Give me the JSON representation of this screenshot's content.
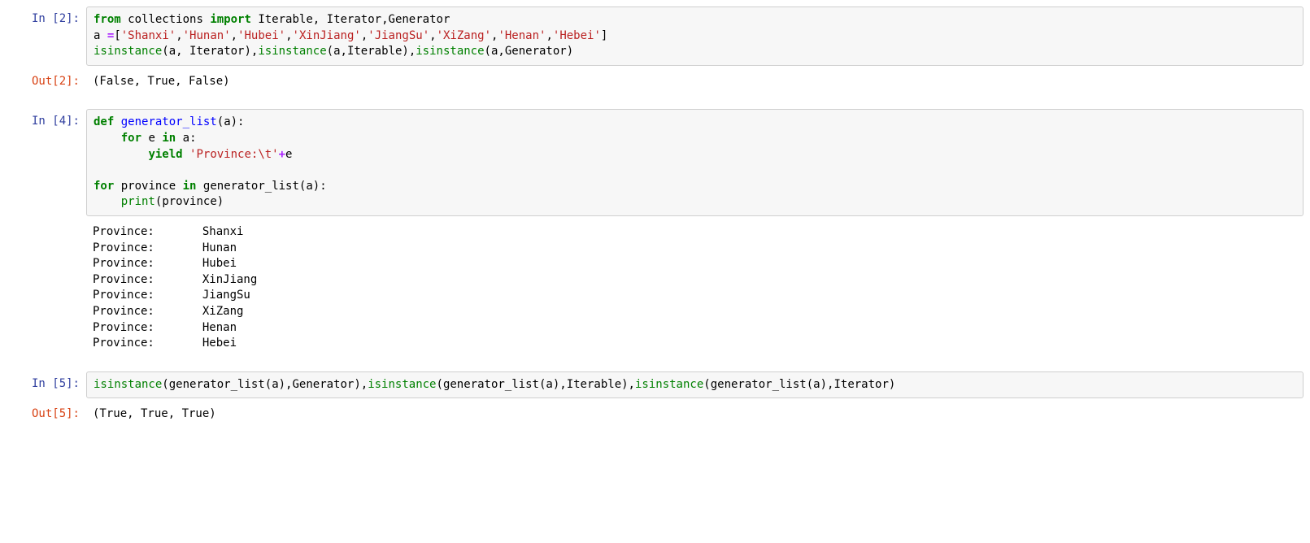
{
  "cells": [
    {
      "prompt_in": "In [2]:",
      "code_html": "<span class='kw-green'>from</span> <span class='name-black'>collections</span> <span class='kw-green'>import</span> <span class='name-black'>Iterable</span><span class='paren'>,</span> <span class='name-black'>Iterator</span><span class='paren'>,</span><span class='name-black'>Generator</span>\n<span class='name-black'>a</span> <span class='op'>=</span><span class='paren'>[</span><span class='str'>'Shanxi'</span><span class='paren'>,</span><span class='str'>'Hunan'</span><span class='paren'>,</span><span class='str'>'Hubei'</span><span class='paren'>,</span><span class='str'>'XinJiang'</span><span class='paren'>,</span><span class='str'>'JiangSu'</span><span class='paren'>,</span><span class='str'>'XiZang'</span><span class='paren'>,</span><span class='str'>'Henan'</span><span class='paren'>,</span><span class='str'>'Hebei'</span><span class='paren'>]</span>\n<span class='builtin'>isinstance</span><span class='paren'>(</span><span class='name-black'>a</span><span class='paren'>,</span> <span class='name-black'>Iterator</span><span class='paren'>),</span><span class='builtin'>isinstance</span><span class='paren'>(</span><span class='name-black'>a</span><span class='paren'>,</span><span class='name-black'>Iterable</span><span class='paren'>),</span><span class='builtin'>isinstance</span><span class='paren'>(</span><span class='name-black'>a</span><span class='paren'>,</span><span class='name-black'>Generator</span><span class='paren'>)</span>",
      "prompt_out": "Out[2]:",
      "out_text": "(False, True, False)"
    },
    {
      "prompt_in": "In [4]:",
      "code_html": "<span class='kw-green'>def</span> <span class='fn-blue'>generator_list</span><span class='paren'>(</span><span class='name-black'>a</span><span class='paren'>):</span>\n    <span class='kw-green'>for</span> <span class='name-black'>e</span> <span class='kw-green'>in</span> <span class='name-black'>a</span><span class='paren'>:</span>\n        <span class='kw-green'>yield</span> <span class='str'>'Province:\\t'</span><span class='op'>+</span><span class='name-black'>e</span>\n\n<span class='kw-green'>for</span> <span class='name-black'>province</span> <span class='kw-green'>in</span> <span class='name-black'>generator_list</span><span class='paren'>(</span><span class='name-black'>a</span><span class='paren'>):</span>\n    <span class='builtin'>print</span><span class='paren'>(</span><span class='name-black'>province</span><span class='paren'>)</span>",
      "stdout_text": "Province:\tShanxi\nProvince:\tHunan\nProvince:\tHubei\nProvince:\tXinJiang\nProvince:\tJiangSu\nProvince:\tXiZang\nProvince:\tHenan\nProvince:\tHebei"
    },
    {
      "prompt_in": "In [5]:",
      "code_html": "<span class='builtin'>isinstance</span><span class='paren'>(</span><span class='name-black'>generator_list</span><span class='paren'>(</span><span class='name-black'>a</span><span class='paren'>),</span><span class='name-black'>Generator</span><span class='paren'>),</span><span class='builtin'>isinstance</span><span class='paren'>(</span><span class='name-black'>generator_list</span><span class='paren'>(</span><span class='name-black'>a</span><span class='paren'>),</span><span class='name-black'>Iterable</span><span class='paren'>),</span><span class='builtin'>isinstance</span><span class='paren'>(</span><span class='name-black'>generator_list</span><span class='paren'>(</span><span class='name-black'>a</span><span class='paren'>),</span><span class='name-black'>Iterator</span><span class='paren'>)</span>",
      "prompt_out": "Out[5]:",
      "out_text": "(True, True, True)"
    }
  ]
}
